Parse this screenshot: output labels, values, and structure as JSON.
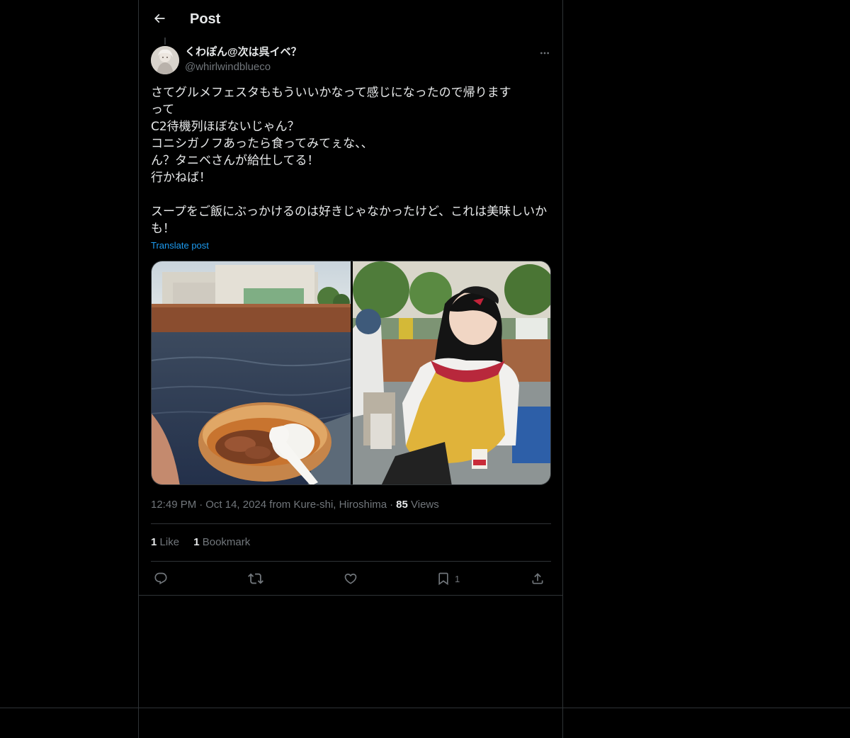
{
  "header": {
    "title": "Post",
    "back_icon": "arrow-left-icon"
  },
  "post": {
    "author": {
      "display_name": "くわぽん@次は呉イベ？",
      "handle": "@whirlwindblueco"
    },
    "text": "さてグルメフェスタももういいかなって感じになったので帰ります\nって\nC2待機列ほぼないじゃん？\nコニシガノフあったら食ってみてぇな、、\nん？タニベさんが給仕してる！\n行かねば！\n\nスープをご飯にぶっかけるのは好きじゃなかったけど、これは美味しいかも！",
    "translate_label": "Translate post",
    "time": "12:49 PM",
    "date_location": "Oct 14, 2024 from Kure-shi, Hiroshima",
    "views_count": "85",
    "views_label": "Views",
    "likes_count": "1",
    "likes_label": "Like",
    "bookmarks_count": "1",
    "bookmarks_label": "Bookmark"
  },
  "actions": {
    "reply_icon": "reply-icon",
    "repost_icon": "repost-icon",
    "like_icon": "heart-icon",
    "bookmark_icon": "bookmark-icon",
    "bookmark_count": "1",
    "share_icon": "share-icon"
  },
  "colors": {
    "background": "#000000",
    "text": "#e7e9ea",
    "secondary": "#71767b",
    "link": "#1d9bf0",
    "border": "#2f3336"
  }
}
